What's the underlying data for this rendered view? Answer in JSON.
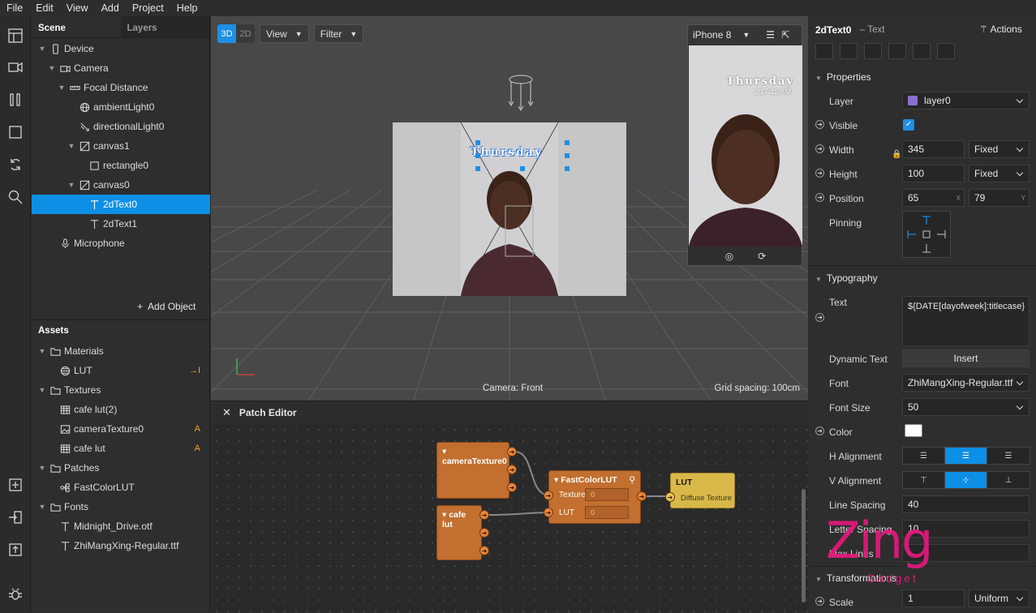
{
  "menu": [
    "File",
    "Edit",
    "View",
    "Add",
    "Project",
    "Help"
  ],
  "scene_panel": {
    "tab_scene": "Scene",
    "tab_layers": "Layers",
    "tree": [
      {
        "label": "Device",
        "icon": "phone-icon",
        "depth": 0,
        "expanded": true
      },
      {
        "label": "Camera",
        "icon": "camera-icon",
        "depth": 1,
        "expanded": true
      },
      {
        "label": "Focal Distance",
        "icon": "ruler-icon",
        "depth": 2,
        "expanded": true
      },
      {
        "label": "ambientLight0",
        "icon": "globe-icon",
        "depth": 3
      },
      {
        "label": "directionalLight0",
        "icon": "directional-light-icon",
        "depth": 3
      },
      {
        "label": "canvas1",
        "icon": "canvas-icon",
        "depth": 3,
        "expanded": true
      },
      {
        "label": "rectangle0",
        "icon": "rectangle-icon",
        "depth": 4
      },
      {
        "label": "canvas0",
        "icon": "canvas-icon",
        "depth": 3,
        "expanded": true
      },
      {
        "label": "2dText0",
        "icon": "text-icon",
        "depth": 4,
        "selected": true
      },
      {
        "label": "2dText1",
        "icon": "text-icon",
        "depth": 4
      },
      {
        "label": "Microphone",
        "icon": "microphone-icon",
        "depth": 1
      }
    ],
    "add_object": "Add Object"
  },
  "assets_panel": {
    "title": "Assets",
    "items": [
      {
        "label": "Materials",
        "icon": "folder-icon",
        "depth": 0,
        "expanded": true
      },
      {
        "label": "LUT",
        "icon": "material-icon",
        "depth": 1,
        "badge": "→I"
      },
      {
        "label": "Textures",
        "icon": "folder-icon",
        "depth": 0,
        "expanded": true
      },
      {
        "label": "cafe lut(2)",
        "icon": "texture-icon",
        "depth": 1
      },
      {
        "label": "cameraTexture0",
        "icon": "image-icon",
        "depth": 1,
        "badge": "A"
      },
      {
        "label": "cafe lut",
        "icon": "texture-icon",
        "depth": 1,
        "badge": "A"
      },
      {
        "label": "Patches",
        "icon": "folder-icon",
        "depth": 0,
        "expanded": true
      },
      {
        "label": "FastColorLUT",
        "icon": "patch-icon",
        "depth": 1
      },
      {
        "label": "Fonts",
        "icon": "folder-icon",
        "depth": 0,
        "expanded": true
      },
      {
        "label": "Midnight_Drive.otf",
        "icon": "text-icon",
        "depth": 1
      },
      {
        "label": "ZhiMangXing-Regular.ttf",
        "icon": "text-icon",
        "depth": 1
      }
    ]
  },
  "viewport": {
    "mode_3d": "3D",
    "mode_2d": "2D",
    "view_label": "View",
    "filter_label": "Filter",
    "overlay_day": "Thursday",
    "overlay_time": "2:17:12 AM",
    "camera_label": "Camera: Front",
    "grid_label": "Grid spacing: 100cm",
    "preview_device": "iPhone 8"
  },
  "patch_editor": {
    "title": "Patch Editor",
    "nodes": {
      "camera_texture": "cameraTexture0",
      "cafe_lut": "cafe lut",
      "fast_color_lut": "FastColorLUT",
      "texture_port": "Texture",
      "lut_port": "LUT",
      "texture_value": "0",
      "lut_value": "0",
      "output_title": "LUT",
      "output_port": "Diffuse Texture"
    }
  },
  "inspector": {
    "object_name": "2dText0",
    "object_type": "– Text",
    "actions": "Actions",
    "properties_title": "Properties",
    "layer_label": "Layer",
    "layer_value": "layer0",
    "visible_label": "Visible",
    "width_label": "Width",
    "width_value": "345",
    "width_mode": "Fixed",
    "height_label": "Height",
    "height_value": "100",
    "height_mode": "Fixed",
    "position_label": "Position",
    "position_x": "65",
    "position_x_axis": "X",
    "position_y": "79",
    "position_y_axis": "Y",
    "pinning_label": "Pinning",
    "typography_title": "Typography",
    "text_label": "Text",
    "text_value": "${DATE[dayofweek]:titlecase}",
    "dynamic_text_label": "Dynamic Text",
    "insert_label": "Insert",
    "font_label": "Font",
    "font_value": "ZhiMangXing-Regular.ttf",
    "font_size_label": "Font Size",
    "font_size_value": "50",
    "color_label": "Color",
    "color_value": "#ffffff",
    "h_alignment_label": "H Alignment",
    "v_alignment_label": "V Alignment",
    "line_spacing_label": "Line Spacing",
    "line_spacing_value": "40",
    "letter_spacing_label": "Letter Spacing",
    "letter_spacing_value": "10",
    "max_lines_label": "Max Lines",
    "max_lines_value": "-",
    "transformations_title": "Transformations",
    "scale_label": "Scale",
    "scale_value": "1",
    "scale_mode": "Uniform"
  },
  "watermark": {
    "main": "Zing",
    "sub": "Gadget"
  },
  "colors": {
    "accent": "#0e8fe6",
    "patch_node": "#c26f30",
    "output_node": "#d9b84a",
    "watermark": "#e4197c"
  }
}
